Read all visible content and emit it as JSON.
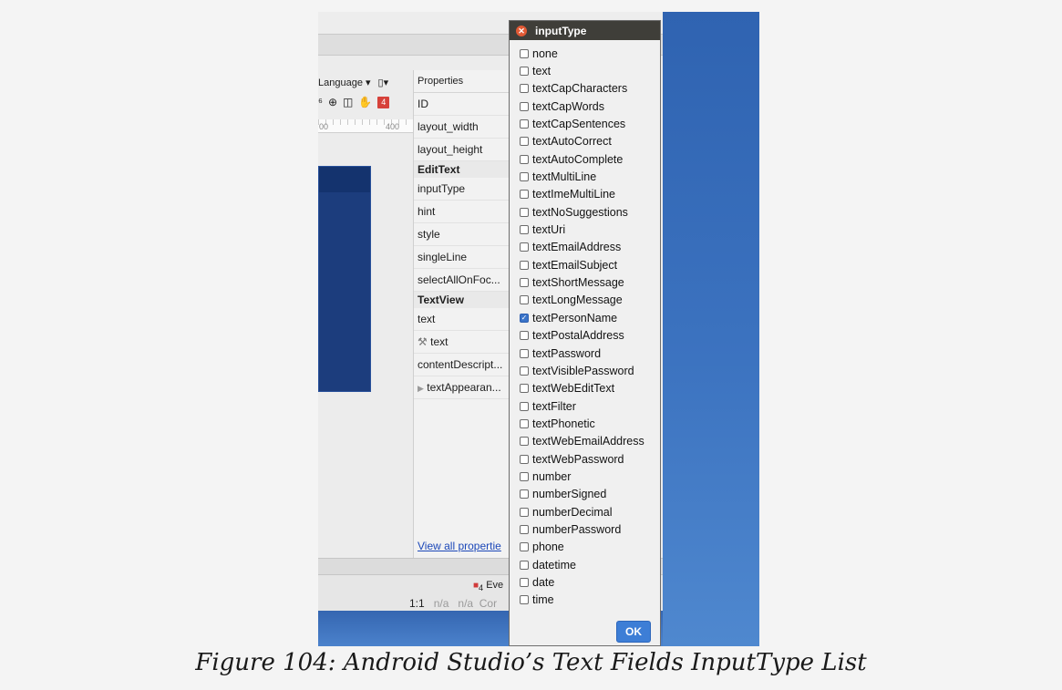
{
  "ide": {
    "toolbar": {
      "language": "Language",
      "device_icon": "phone-device-icon"
    },
    "ruler": {
      "left_tick": "00",
      "right_tick": "400"
    },
    "badge": "4",
    "properties": {
      "header": "Properties",
      "rows": [
        {
          "label": "ID"
        },
        {
          "label": "layout_width"
        },
        {
          "label": "layout_height"
        }
      ],
      "section_edittext": "EditText",
      "edittext_rows": [
        {
          "label": "inputType"
        },
        {
          "label": "hint"
        },
        {
          "label": "style"
        },
        {
          "label": "singleLine"
        },
        {
          "label": "selectAllOnFoc..."
        }
      ],
      "section_textview": "TextView",
      "textview_rows": [
        {
          "label": "text"
        },
        {
          "label": "text"
        },
        {
          "label": "contentDescript..."
        },
        {
          "label": "textAppearan..."
        }
      ],
      "view_all": "View all propertie"
    },
    "statusbar": {
      "events_label": "Eve",
      "events_count": "4"
    },
    "position": {
      "caret": "1:1",
      "na1": "n/a",
      "na2": "n/a",
      "context": "Cor"
    }
  },
  "dialog": {
    "title": "inputType",
    "options": [
      {
        "label": "none",
        "checked": false
      },
      {
        "label": "text",
        "checked": false
      },
      {
        "label": "textCapCharacters",
        "checked": false
      },
      {
        "label": "textCapWords",
        "checked": false
      },
      {
        "label": "textCapSentences",
        "checked": false
      },
      {
        "label": "textAutoCorrect",
        "checked": false
      },
      {
        "label": "textAutoComplete",
        "checked": false
      },
      {
        "label": "textMultiLine",
        "checked": false
      },
      {
        "label": "textImeMultiLine",
        "checked": false
      },
      {
        "label": "textNoSuggestions",
        "checked": false
      },
      {
        "label": "textUri",
        "checked": false
      },
      {
        "label": "textEmailAddress",
        "checked": false
      },
      {
        "label": "textEmailSubject",
        "checked": false
      },
      {
        "label": "textShortMessage",
        "checked": false
      },
      {
        "label": "textLongMessage",
        "checked": false
      },
      {
        "label": "textPersonName",
        "checked": true
      },
      {
        "label": "textPostalAddress",
        "checked": false
      },
      {
        "label": "textPassword",
        "checked": false
      },
      {
        "label": "textVisiblePassword",
        "checked": false
      },
      {
        "label": "textWebEditText",
        "checked": false
      },
      {
        "label": "textFilter",
        "checked": false
      },
      {
        "label": "textPhonetic",
        "checked": false
      },
      {
        "label": "textWebEmailAddress",
        "checked": false
      },
      {
        "label": "textWebPassword",
        "checked": false
      },
      {
        "label": "number",
        "checked": false
      },
      {
        "label": "numberSigned",
        "checked": false
      },
      {
        "label": "numberDecimal",
        "checked": false
      },
      {
        "label": "numberPassword",
        "checked": false
      },
      {
        "label": "phone",
        "checked": false
      },
      {
        "label": "datetime",
        "checked": false
      },
      {
        "label": "date",
        "checked": false
      },
      {
        "label": "time",
        "checked": false
      }
    ],
    "ok_label": "OK"
  },
  "caption": "Figure 104: Android Studio’s Text Fields InputType List"
}
